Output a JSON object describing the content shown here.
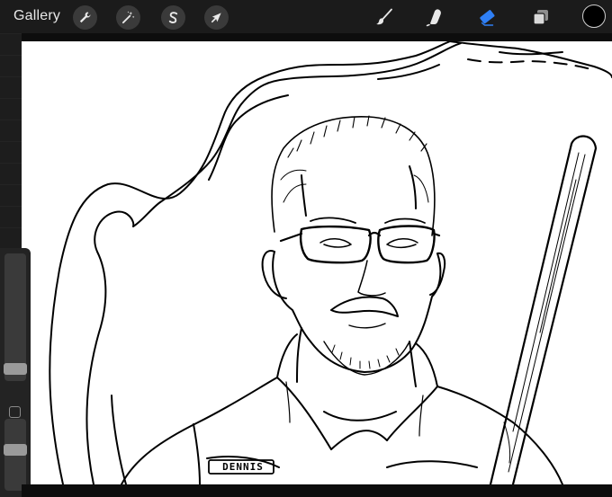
{
  "toolbar": {
    "gallery_label": "Gallery",
    "left_tools": [
      {
        "icon": "wrench-icon",
        "name": "actions"
      },
      {
        "icon": "magic-wand-icon",
        "name": "adjustments"
      },
      {
        "icon": "selection-s-icon",
        "name": "selection"
      },
      {
        "icon": "arrow-cursor-icon",
        "name": "transform"
      }
    ],
    "right_tools": [
      {
        "icon": "brush-icon",
        "name": "paint"
      },
      {
        "icon": "smudge-icon",
        "name": "smudge"
      },
      {
        "icon": "eraser-icon",
        "name": "erase",
        "active": true
      },
      {
        "icon": "layers-icon",
        "name": "layers"
      }
    ],
    "active_color": "#000000",
    "accent_color": "#2f7ff5"
  },
  "sidebar": {
    "brush_size_level": 0.3,
    "opacity_level": 0.2
  },
  "canvas": {
    "name_tag_text": "DENNIS",
    "background": "#ffffff"
  }
}
